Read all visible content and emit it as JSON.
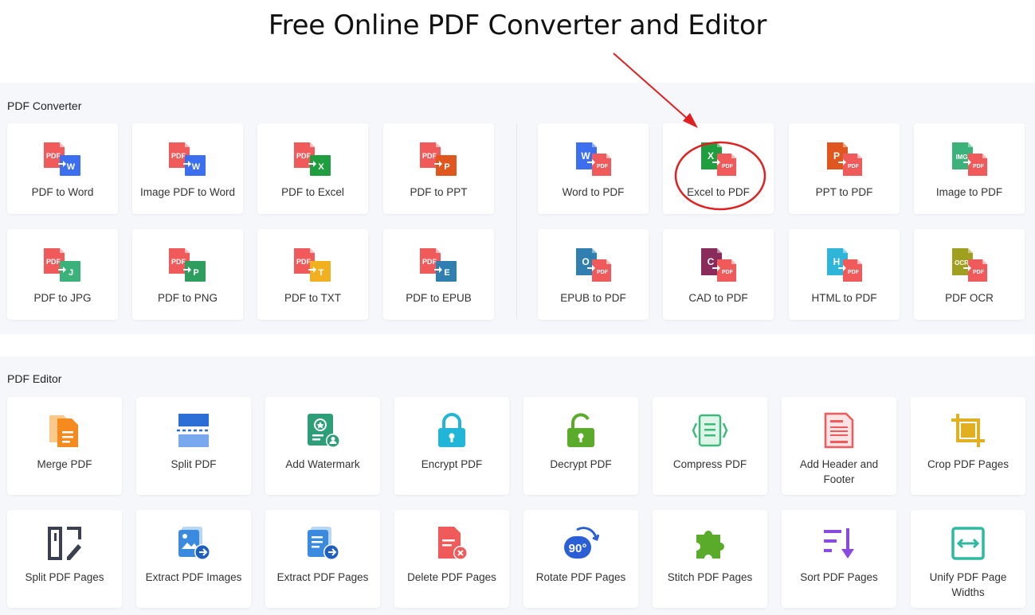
{
  "title": "Free Online PDF Converter and Editor",
  "converter": {
    "section_title": "PDF Converter",
    "left_items": [
      {
        "label": "PDF to Word",
        "icon": "pdf-to-word-icon",
        "badge": "W",
        "badge_color": "#3b6ff0"
      },
      {
        "label": "Image PDF to Word",
        "icon": "image-pdf-to-word-icon",
        "badge": "W",
        "badge_color": "#3b6ff0"
      },
      {
        "label": "PDF to Excel",
        "icon": "pdf-to-excel-icon",
        "badge": "X",
        "badge_color": "#1f9e3f"
      },
      {
        "label": "PDF to PPT",
        "icon": "pdf-to-ppt-icon",
        "badge": "P",
        "badge_color": "#e0561f"
      },
      {
        "label": "PDF to JPG",
        "icon": "pdf-to-jpg-icon",
        "badge": "J",
        "badge_color": "#3bb27a"
      },
      {
        "label": "PDF to PNG",
        "icon": "pdf-to-png-icon",
        "badge": "P",
        "badge_color": "#2e9e5e"
      },
      {
        "label": "PDF to TXT",
        "icon": "pdf-to-txt-icon",
        "badge": "T",
        "badge_color": "#f0b020"
      },
      {
        "label": "PDF to EPUB",
        "icon": "pdf-to-epub-icon",
        "badge": "E",
        "badge_color": "#2f7fb0"
      }
    ],
    "right_items": [
      {
        "label": "Word to PDF",
        "icon": "word-to-pdf-icon",
        "badge": "W",
        "badge_color": "#3b6ff0"
      },
      {
        "label": "Excel to PDF",
        "icon": "excel-to-pdf-icon",
        "badge": "X",
        "badge_color": "#1f9e3f"
      },
      {
        "label": "PPT to PDF",
        "icon": "ppt-to-pdf-icon",
        "badge": "P",
        "badge_color": "#e0561f"
      },
      {
        "label": "Image to PDF",
        "icon": "image-to-pdf-icon",
        "badge": "IMG",
        "badge_color": "#3bb27a"
      },
      {
        "label": "EPUB to PDF",
        "icon": "epub-to-pdf-icon",
        "badge": "O",
        "badge_color": "#2f7fb0"
      },
      {
        "label": "CAD to PDF",
        "icon": "cad-to-pdf-icon",
        "badge": "C",
        "badge_color": "#8a2b5c"
      },
      {
        "label": "HTML to PDF",
        "icon": "html-to-pdf-icon",
        "badge": "H",
        "badge_color": "#2fb5d8"
      },
      {
        "label": "PDF OCR",
        "icon": "pdf-ocr-icon",
        "badge": "OCR",
        "badge_color": "#a0a020"
      }
    ],
    "pdf_label": "PDF",
    "pdf_color": "#f05a5a"
  },
  "editor": {
    "section_title": "PDF Editor",
    "items": [
      {
        "label": "Merge PDF",
        "icon": "merge-pdf-icon",
        "color": "#f58a1f"
      },
      {
        "label": "Split PDF",
        "icon": "split-pdf-icon",
        "color": "#2b6fd6"
      },
      {
        "label": "Add Watermark",
        "icon": "watermark-icon",
        "color": "#2e9e78"
      },
      {
        "label": "Encrypt PDF",
        "icon": "lock-icon",
        "color": "#21b5d8"
      },
      {
        "label": "Decrypt PDF",
        "icon": "unlock-icon",
        "color": "#5aab2a"
      },
      {
        "label": "Compress PDF",
        "icon": "compress-icon",
        "color": "#3cba7a"
      },
      {
        "label": "Add Header and Footer",
        "icon": "header-footer-icon",
        "color": "#f05a5a"
      },
      {
        "label": "Crop PDF Pages",
        "icon": "crop-icon",
        "color": "#e0b020"
      },
      {
        "label": "Split PDF Pages",
        "icon": "split-pages-icon",
        "color": "#3a4050"
      },
      {
        "label": "Extract PDF Images",
        "icon": "extract-images-icon",
        "color": "#3a8be0"
      },
      {
        "label": "Extract PDF Pages",
        "icon": "extract-pages-icon",
        "color": "#3a8be0"
      },
      {
        "label": "Delete PDF Pages",
        "icon": "delete-pages-icon",
        "color": "#f05a5a"
      },
      {
        "label": "Rotate PDF Pages",
        "icon": "rotate-icon",
        "color": "#2b5fd6",
        "badge": "90°"
      },
      {
        "label": "Stitch PDF Pages",
        "icon": "puzzle-icon",
        "color": "#5aab2a"
      },
      {
        "label": "Sort PDF Pages",
        "icon": "sort-icon",
        "color": "#8a4be0"
      },
      {
        "label": "Unify PDF Page Widths",
        "icon": "unify-width-icon",
        "color": "#2ebaa0"
      }
    ]
  }
}
